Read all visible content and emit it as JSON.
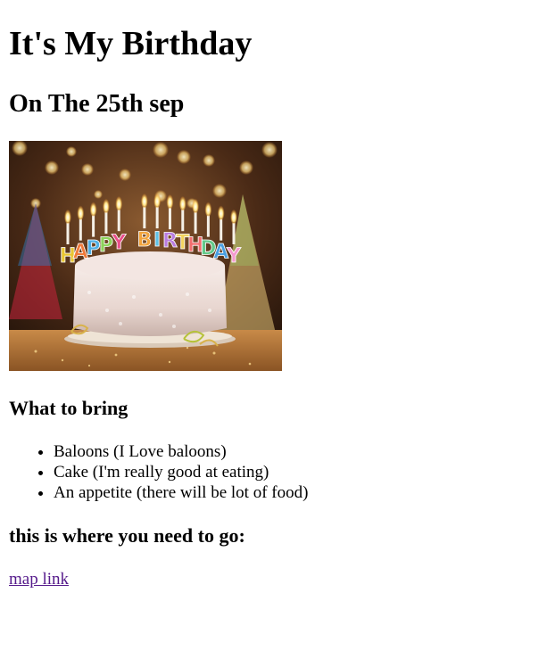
{
  "header": {
    "title": "It's My Birthday",
    "subtitle": "On The 25th sep"
  },
  "image": {
    "candle_letters": "HAPPY BIRTHDAY",
    "letter_colors": [
      "#e8c531",
      "#f07a3a",
      "#4fb0e6",
      "#8ed15b",
      "#ea4f8a",
      "#f3a43b",
      "#5ec3e8",
      "#b97ce0",
      "#f3d35d",
      "#f26d6d",
      "#63c98a",
      "#4a9ee0",
      "#f59ad0",
      "#e0c24a"
    ]
  },
  "bring": {
    "heading": "What to bring",
    "items": [
      "Baloons (I Love baloons)",
      "Cake (I'm really good at eating)",
      "An appetite (there will be lot of food)"
    ]
  },
  "directions": {
    "heading": "this is where you need to go:",
    "link_label": "map link"
  },
  "colors": {
    "visited_link": "#551a8b"
  }
}
